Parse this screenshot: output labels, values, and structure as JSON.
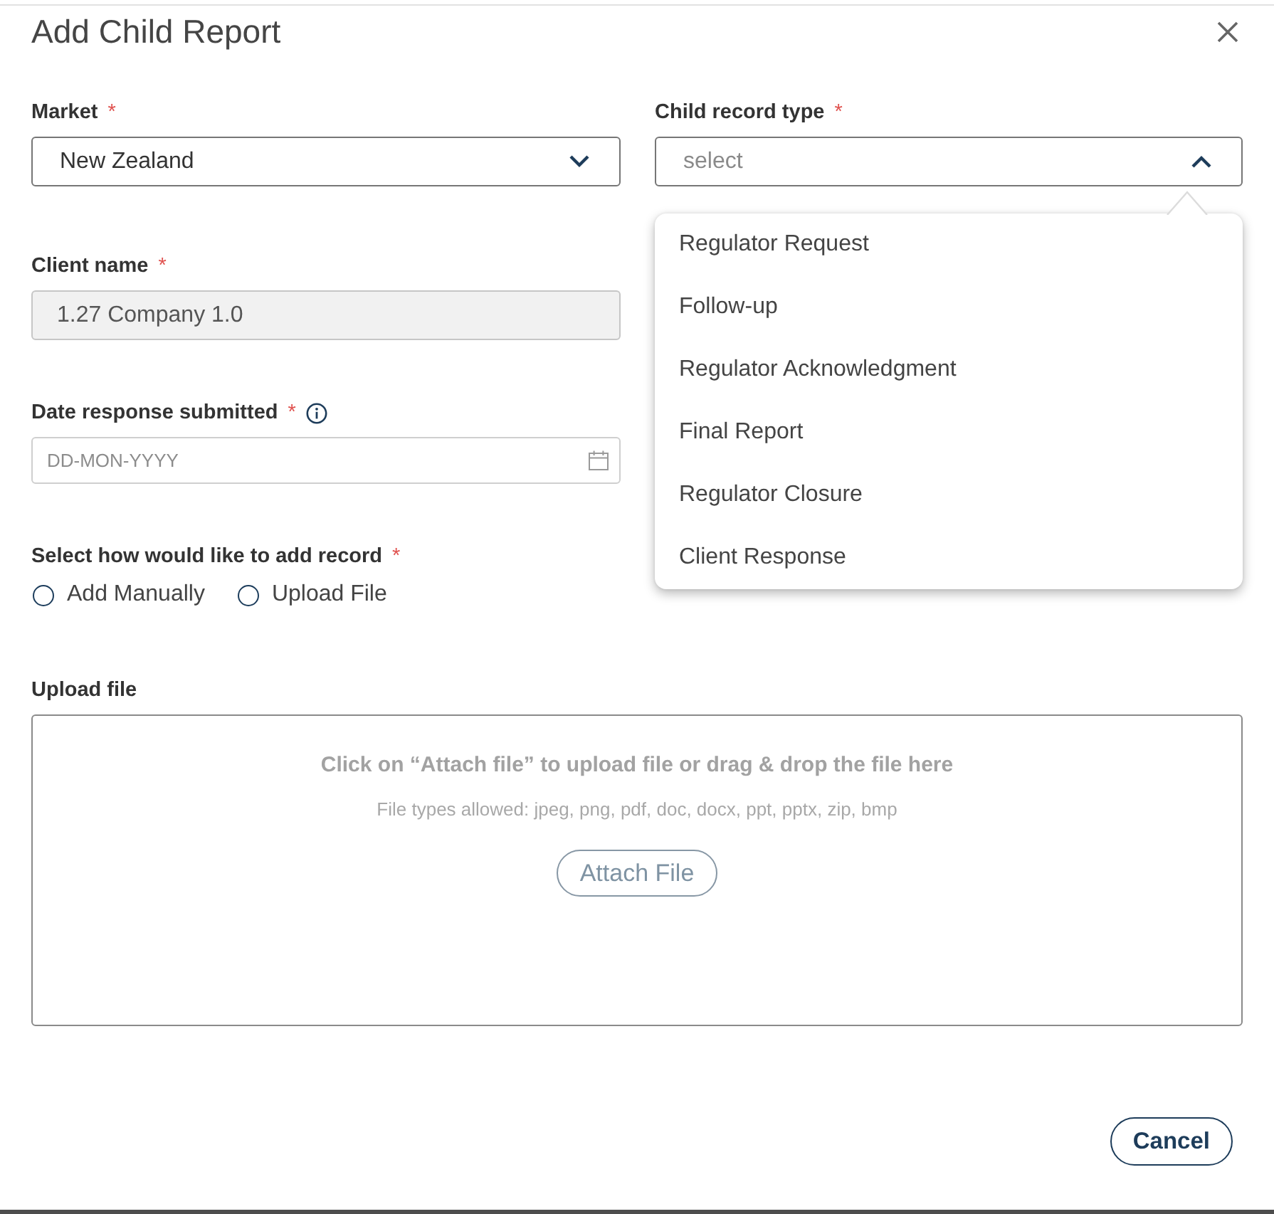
{
  "dialog": {
    "title": "Add Child Report"
  },
  "market": {
    "label": "Market",
    "required_mark": "*",
    "value": "New Zealand",
    "expanded": false
  },
  "child_record_type": {
    "label": "Child record type",
    "required_mark": "*",
    "placeholder": "select",
    "expanded": true,
    "options": [
      {
        "label": "Regulator Request",
        "selected": false
      },
      {
        "label": "Follow-up",
        "selected": false
      },
      {
        "label": "Regulator Acknowledgment",
        "selected": false
      },
      {
        "label": "Final Report",
        "selected": false
      },
      {
        "label": "Regulator Closure",
        "selected": false
      },
      {
        "label": "Client Response",
        "selected": false
      }
    ]
  },
  "client_name": {
    "label": "Client name",
    "required_mark": "*",
    "value": "1.27 Company 1.0",
    "disabled": true
  },
  "date_response_submitted": {
    "label": "Date response submitted",
    "required_mark": "*",
    "placeholder": "DD-MON-YYYY"
  },
  "add_method": {
    "label": "Select how would like to add record",
    "required_mark": "*",
    "options": [
      {
        "label": "Add Manually",
        "selected": false
      },
      {
        "label": "Upload File",
        "selected": false
      }
    ]
  },
  "upload_file": {
    "label": "Upload file",
    "prompt": "Click on “Attach file” to upload file or drag & drop the file here",
    "hint": "File types allowed: jpeg, png, pdf, doc, docx, ppt, pptx, zip, bmp",
    "button": "Attach File"
  },
  "footer": {
    "buttons": [
      {
        "label": "Cancel"
      }
    ]
  }
}
